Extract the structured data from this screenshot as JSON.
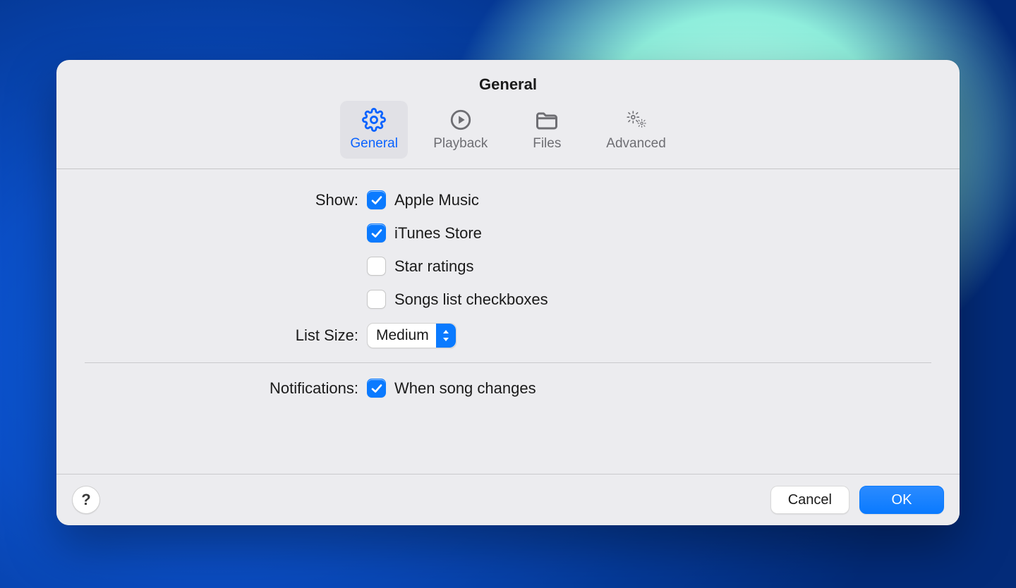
{
  "window": {
    "title": "General"
  },
  "tabs": {
    "general": {
      "label": "General"
    },
    "playback": {
      "label": "Playback"
    },
    "files": {
      "label": "Files"
    },
    "advanced": {
      "label": "Advanced"
    }
  },
  "sections": {
    "show": {
      "label": "Show:",
      "options": {
        "apple_music": {
          "label": "Apple Music",
          "checked": true
        },
        "itunes_store": {
          "label": "iTunes Store",
          "checked": true
        },
        "star_ratings": {
          "label": "Star ratings",
          "checked": false
        },
        "songs_checkboxes": {
          "label": "Songs list checkboxes",
          "checked": false
        }
      }
    },
    "list_size": {
      "label": "List Size:",
      "value": "Medium"
    },
    "notifications": {
      "label": "Notifications:",
      "options": {
        "song_changes": {
          "label": "When song changes",
          "checked": true
        }
      }
    }
  },
  "footer": {
    "help": "?",
    "cancel": "Cancel",
    "ok": "OK"
  },
  "colors": {
    "accent": "#0a7aff"
  }
}
